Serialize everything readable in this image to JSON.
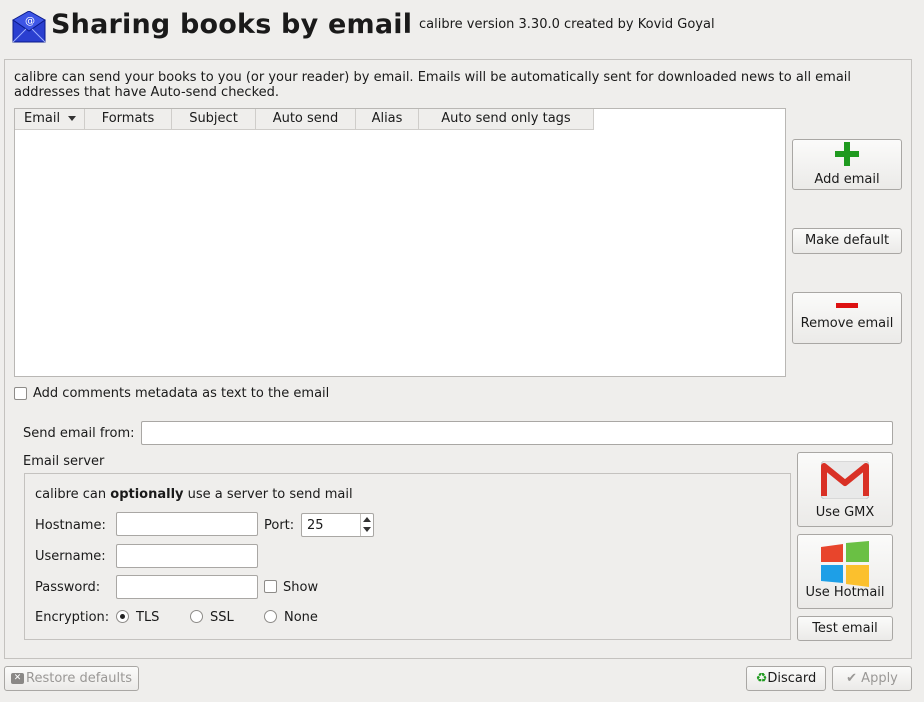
{
  "header": {
    "title": "Sharing books by email",
    "version": "calibre version 3.30.0 created by Kovid Goyal",
    "icon": "email-envelope-icon"
  },
  "description": "calibre can send your books to you (or your reader) by email. Emails will be automatically sent for downloaded news to all email addresses that have Auto-send checked.",
  "table": {
    "columns": [
      "Email",
      "Formats",
      "Subject",
      "Auto send",
      "Alias",
      "Auto send only tags"
    ],
    "rows": []
  },
  "side_buttons": {
    "add": {
      "label": "Add email",
      "icon": "plus-icon"
    },
    "make_default": {
      "label": "Make default"
    },
    "remove": {
      "label": "Remove email",
      "icon": "minus-icon"
    }
  },
  "comments_checkbox": {
    "label": "Add comments metadata as text to the email",
    "checked": false
  },
  "send_from": {
    "label": "Send email from:",
    "value": ""
  },
  "server": {
    "title": "Email server",
    "intro_prefix": "calibre can ",
    "intro_bold": "optionally",
    "intro_suffix": " use a server to send mail",
    "hostname": {
      "label": "Hostname:",
      "value": ""
    },
    "port": {
      "label": "Port:",
      "value": "25"
    },
    "username": {
      "label": "Username:",
      "value": ""
    },
    "password": {
      "label": "Password:",
      "value": ""
    },
    "show": {
      "label": "Show",
      "checked": false
    },
    "encryption": {
      "label": "Encryption:",
      "options": [
        "TLS",
        "SSL",
        "None"
      ],
      "selected": "TLS"
    }
  },
  "providers": {
    "gmx": {
      "label": "Use GMX",
      "icon": "gmail-logo-icon"
    },
    "hotmail": {
      "label": "Use Hotmail",
      "icon": "windows-logo-icon"
    },
    "test": {
      "label": "Test email"
    }
  },
  "footer": {
    "restore": "Restore defaults",
    "discard": "Discard",
    "apply": "Apply"
  },
  "colors": {
    "accent_green": "#1f9a1f",
    "accent_red": "#dd1111",
    "gmail_red": "#d93025"
  }
}
